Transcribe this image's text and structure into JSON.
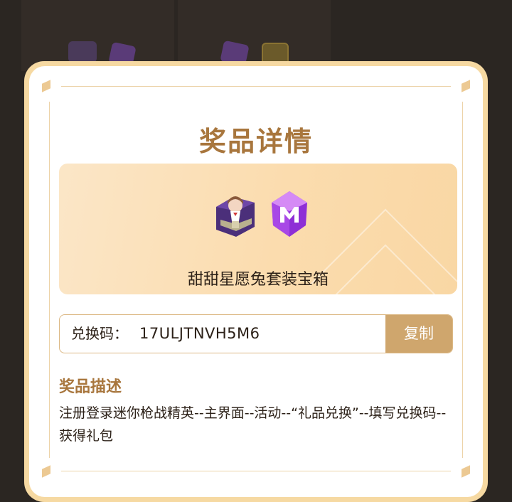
{
  "modal": {
    "title": "奖品详情",
    "prize": {
      "name": "甜甜星愿兔套装宝箱",
      "icons": [
        "treasure-chest-icon",
        "purple-gem-icon"
      ]
    },
    "redeem": {
      "label": "兑换码：",
      "code": "17ULJTNVH5M6",
      "copy_label": "复制"
    },
    "description": {
      "heading": "奖品描述",
      "text": "注册登录迷你枪战精英--主界面--活动--“礼品兑换”--填写兑换码--获得礼包"
    }
  },
  "colors": {
    "accent": "#a8763d",
    "copy_button": "#cfa66d",
    "modal_border": "#f6d9a2",
    "card_bg": "#fbdcae"
  }
}
